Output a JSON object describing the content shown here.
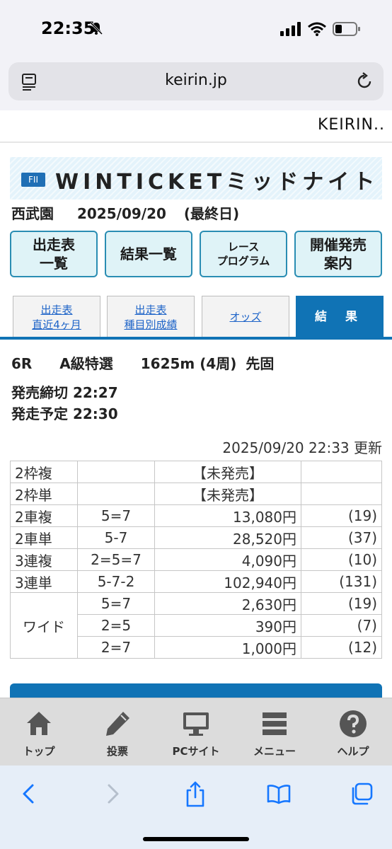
{
  "status_bar": {
    "time": "22:35"
  },
  "browser": {
    "url": "keirin.jp"
  },
  "site": {
    "logo": "KEIRIN.."
  },
  "race": {
    "grade_badge": "FII",
    "title": "WINTICKETミッドナイト",
    "venue": "西武園",
    "date": "2025/09/20",
    "day": "(最終日)"
  },
  "buttons": [
    {
      "label": "出走表\n一覧"
    },
    {
      "label": "結果一覧"
    },
    {
      "label": "レース\nプログラム"
    },
    {
      "label": "開催発売\n案内"
    }
  ],
  "tabs": [
    {
      "label": "出走表\n直近4ヶ月"
    },
    {
      "label": "出走表\n種目別成績"
    },
    {
      "label": "オッズ"
    },
    {
      "label": "結 果"
    }
  ],
  "race_info": {
    "number": "6R",
    "class": "A級特選",
    "distance": "1625m (4周)",
    "start": "先固"
  },
  "deadline": {
    "close": "発売締切 22:27",
    "start": "発走予定 22:30"
  },
  "updated": "2025/09/20 22:33 更新",
  "results": [
    {
      "type": "2枠複",
      "combo": "",
      "payout": "【未発売】",
      "pop": ""
    },
    {
      "type": "2枠単",
      "combo": "",
      "payout": "【未発売】",
      "pop": ""
    },
    {
      "type": "2車複",
      "combo": "5=7",
      "payout": "13,080円",
      "pop": "(19)"
    },
    {
      "type": "2車単",
      "combo": "5-7",
      "payout": "28,520円",
      "pop": "(37)"
    },
    {
      "type": "3連複",
      "combo": "2=5=7",
      "payout": "4,090円",
      "pop": "(10)"
    },
    {
      "type": "3連単",
      "combo": "5-7-2",
      "payout": "102,940円",
      "pop": "(131)"
    }
  ],
  "wide": {
    "type": "ワイド",
    "rows": [
      {
        "combo": "5=7",
        "payout": "2,630円",
        "pop": "(19)"
      },
      {
        "combo": "2=5",
        "payout": "390円",
        "pop": "(7)"
      },
      {
        "combo": "2=7",
        "payout": "1,000円",
        "pop": "(12)"
      }
    ]
  },
  "bottom_nav": [
    {
      "label": "トップ",
      "icon": "home-icon"
    },
    {
      "label": "投票",
      "icon": "pencil-icon"
    },
    {
      "label": "PCサイト",
      "icon": "monitor-icon"
    },
    {
      "label": "メニュー",
      "icon": "menu-icon"
    },
    {
      "label": "ヘルプ",
      "icon": "help-icon"
    }
  ],
  "colors": {
    "accent": "#1073b5",
    "button_bg": "#dff3f7",
    "link": "#1e64c8"
  }
}
